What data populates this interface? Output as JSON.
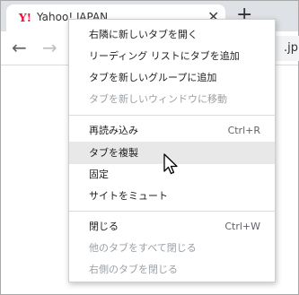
{
  "browser": {
    "tab": {
      "title": "Yahoo! JAPAN",
      "favicon": "Y!",
      "close_icon": "✕"
    },
    "new_tab_icon": "+",
    "nav": {
      "back_icon": "←",
      "forward_icon": "→"
    },
    "omnibox_tail": ".jp"
  },
  "context_menu": {
    "items": [
      {
        "label": "右隣に新しいタブを開く",
        "shortcut": "",
        "enabled": true
      },
      {
        "label": "リーディング リストにタブを追加",
        "shortcut": "",
        "enabled": true
      },
      {
        "label": "タブを新しいグループに追加",
        "shortcut": "",
        "enabled": true
      },
      {
        "label": "タブを新しいウィンドウに移動",
        "shortcut": "",
        "enabled": false
      },
      {
        "label": "再読み込み",
        "shortcut": "Ctrl+R",
        "enabled": true
      },
      {
        "label": "タブを複製",
        "shortcut": "",
        "enabled": true,
        "hovered": true
      },
      {
        "label": "固定",
        "shortcut": "",
        "enabled": true
      },
      {
        "label": "サイトをミュート",
        "shortcut": "",
        "enabled": true
      },
      {
        "label": "閉じる",
        "shortcut": "Ctrl+W",
        "enabled": true
      },
      {
        "label": "他のタブをすべて閉じる",
        "shortcut": "",
        "enabled": false
      },
      {
        "label": "右側のタブを閉じる",
        "shortcut": "",
        "enabled": false
      }
    ]
  },
  "colors": {
    "accent_favicon": "#ff0033",
    "menu_hover": "#e8e8e8",
    "disabled_text": "#9aa0a6"
  }
}
